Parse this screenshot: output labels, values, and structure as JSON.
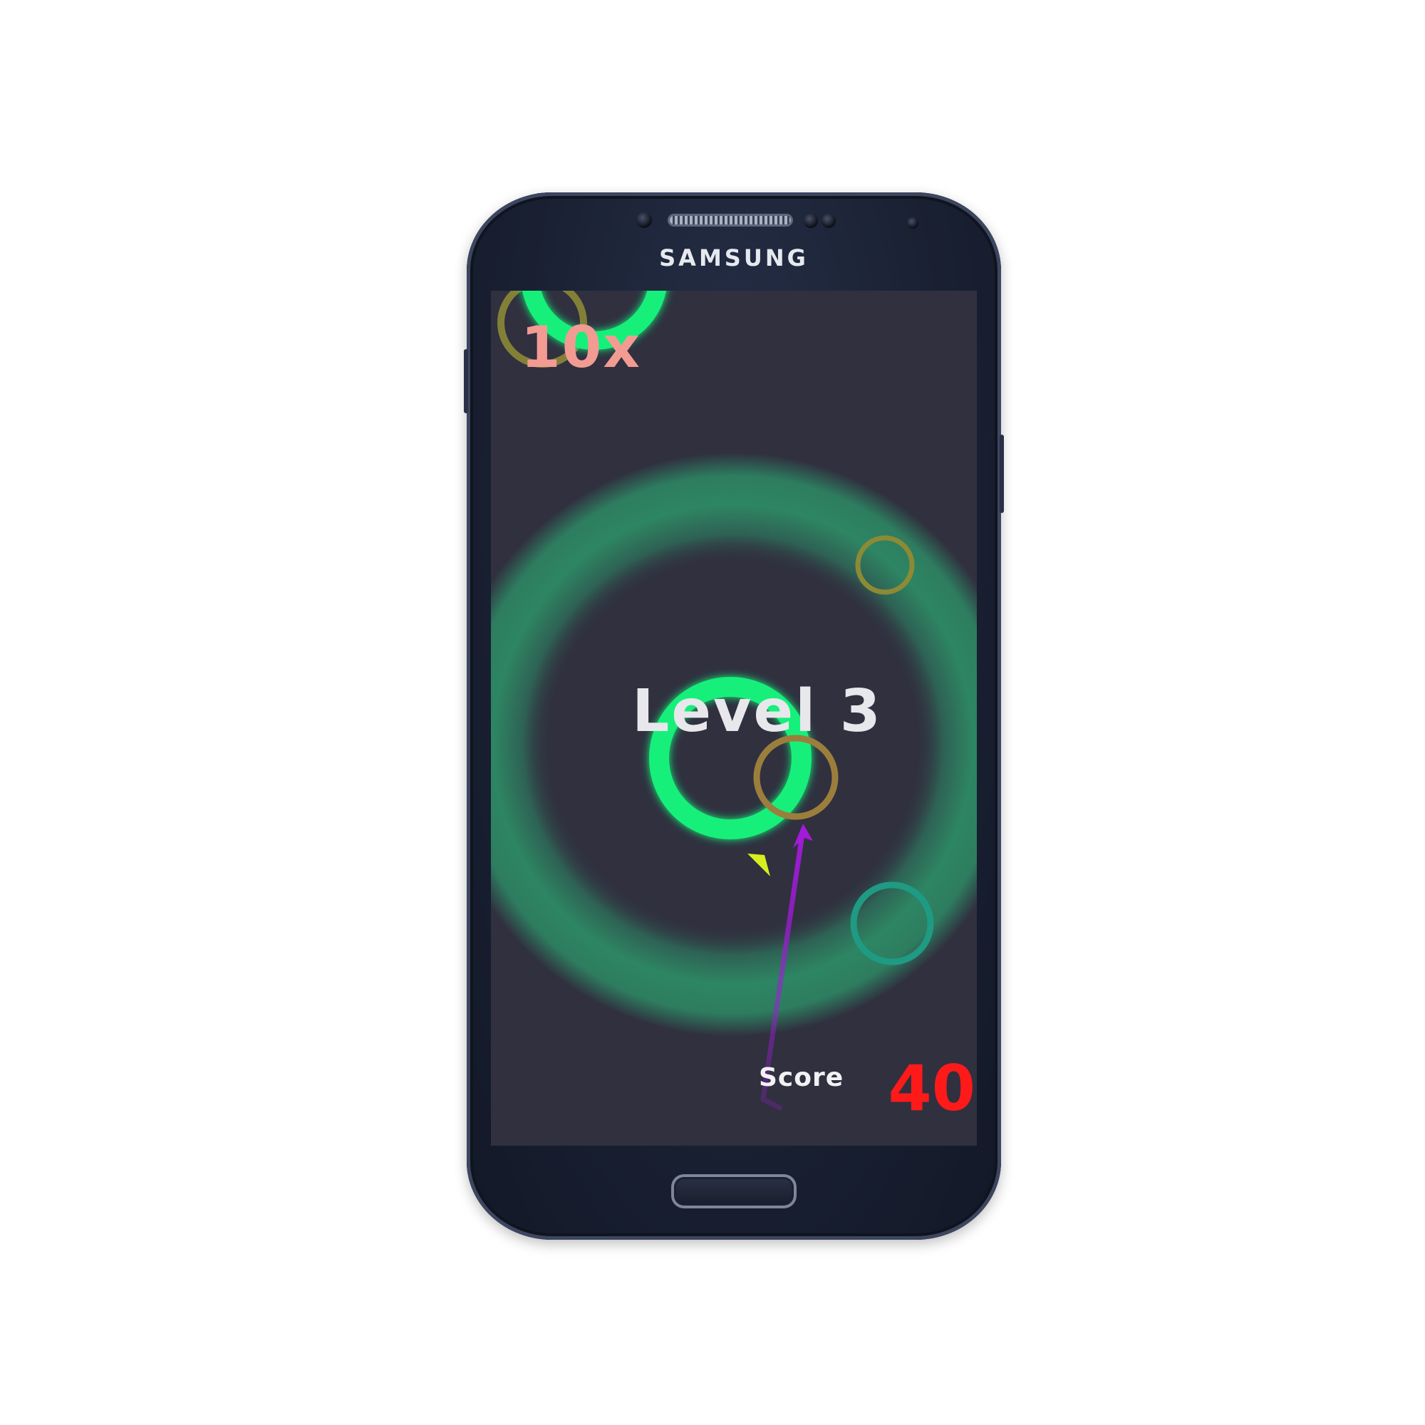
{
  "device": {
    "brand": "SAMSUNG"
  },
  "hud": {
    "multiplier": "10x",
    "level_title": "Level 3",
    "score_label": "Score",
    "score_value": "40"
  },
  "colors": {
    "screen_background": "#30303f",
    "glow_ring": "#2d8a65",
    "target_ring": "#12f07a",
    "olive_ring": "#8c8a35",
    "tan_ring": "#9c7e3c",
    "teal_ring": "#1f9a83",
    "player_trail": "#a11bd9",
    "pointer": "#d7ef1c",
    "multiplier_text": "#f29b93",
    "score_text": "#ff1a1a"
  },
  "icons": {
    "player": "purple-arrow-icon",
    "pointer": "yellow-triangle-icon"
  }
}
